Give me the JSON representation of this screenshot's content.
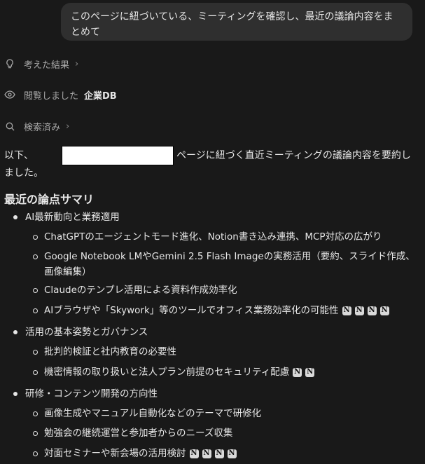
{
  "user_message": "このページに紐づいている、ミーティングを確認し、最近の議論内容をまとめて",
  "status": {
    "thought_label": "考えた結果",
    "viewed_label": "閲覧しました",
    "viewed_target": "企業DB",
    "searched_label": "検索済み"
  },
  "intro": {
    "prefix": "以下、",
    "suffix": "ページに紐づく直近ミーティングの議論内容を要約しました。"
  },
  "section_title": "最近の論点サマリ",
  "topics": [
    {
      "title": "AI最新動向と業務適用",
      "points": [
        {
          "text": "ChatGPTのエージェントモード進化、Notion書き込み連携、MCP対応の広がり",
          "cites": 0
        },
        {
          "text": "Google Notebook LMやGemini 2.5 Flash Imageの実務活用（要約、スライド作成、画像編集）",
          "cites": 0
        },
        {
          "text": "Claudeのテンプレ活用による資料作成効率化",
          "cites": 0
        },
        {
          "text": "AIブラウザや「Skywork」等のツールでオフィス業務効率化の可能性",
          "cites": 4
        }
      ]
    },
    {
      "title": "活用の基本姿勢とガバナンス",
      "points": [
        {
          "text": "批判的検証と社内教育の必要性",
          "cites": 0
        },
        {
          "text": "機密情報の取り扱いと法人プラン前提のセキュリティ配慮",
          "cites": 2
        }
      ]
    },
    {
      "title": "研修・コンテンツ開発の方向性",
      "points": [
        {
          "text": "画像生成やマニュアル自動化などのテーマで研修化",
          "cites": 0
        },
        {
          "text": "勉強会の継続運営と参加者からのニーズ収集",
          "cites": 0
        },
        {
          "text": "対面セミナーや新会場の活用検討",
          "cites": 4
        }
      ]
    }
  ],
  "cite_glyph": "N"
}
